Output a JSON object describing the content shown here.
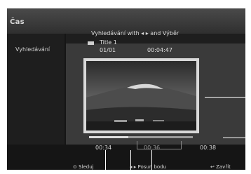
{
  "screen": {
    "title": "Čas",
    "sidebar_label": "Vyhledávání",
    "hint": "Vyhledávání with ◂ ▸ and Výběr",
    "title_name": "Title 1",
    "chapter": "01/01",
    "total_time": "00:04:47",
    "start_time": "00:34",
    "selected_time": "00:36",
    "end_time": "00:38",
    "scrub_progress": 0.38
  },
  "footer": {
    "play": "⊙ Sleduj",
    "move": "◂ ▸ Posun bodu",
    "close": "↩ Zavřít"
  },
  "colors": {
    "panel_bg": "#3a3a3a",
    "screen_bg": "#151515",
    "text": "#d8d8d8"
  }
}
